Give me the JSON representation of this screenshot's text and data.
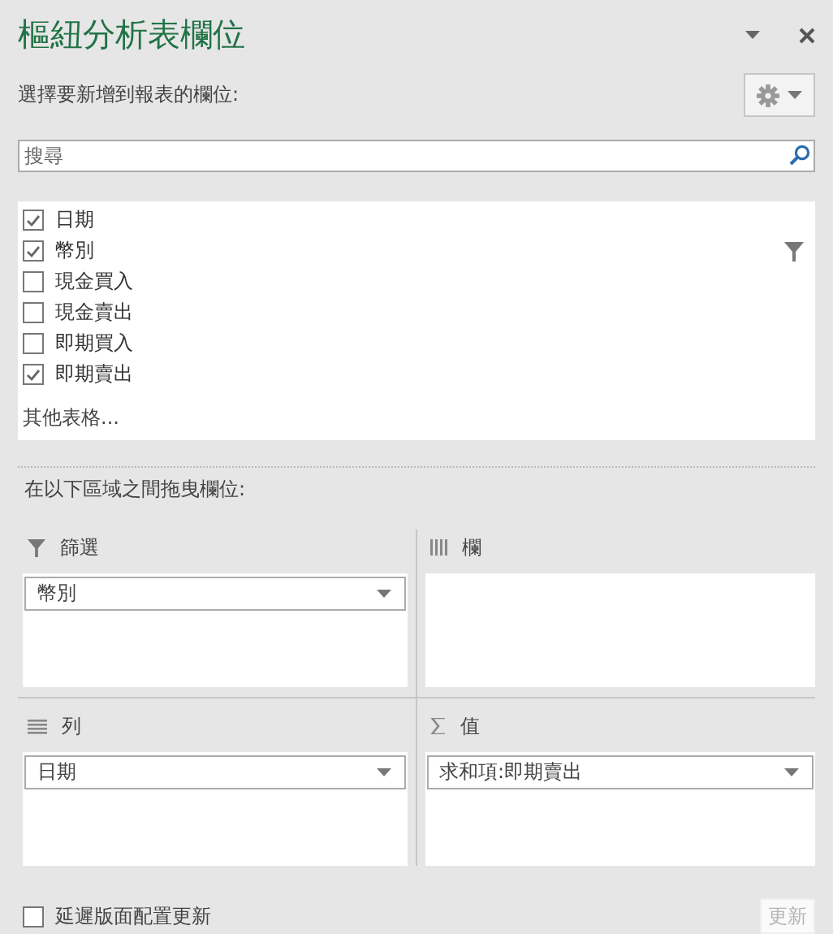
{
  "title": "樞紐分析表欄位",
  "choose_label": "選擇要新增到報表的欄位:",
  "search": {
    "placeholder": "搜尋"
  },
  "fields": [
    {
      "label": "日期",
      "checked": true,
      "filtered": false
    },
    {
      "label": "幣別",
      "checked": true,
      "filtered": true
    },
    {
      "label": "現金買入",
      "checked": false,
      "filtered": false
    },
    {
      "label": "現金賣出",
      "checked": false,
      "filtered": false
    },
    {
      "label": "即期買入",
      "checked": false,
      "filtered": false
    },
    {
      "label": "即期賣出",
      "checked": true,
      "filtered": false
    }
  ],
  "more_tables": "其他表格...",
  "drag_label": "在以下區域之間拖曳欄位:",
  "areas": [
    {
      "kind": "filter",
      "title": "篩選",
      "items": [
        "幣別"
      ]
    },
    {
      "kind": "columns",
      "title": "欄"
    },
    {
      "kind": "rows",
      "title": "列",
      "items": [
        "日期"
      ]
    },
    {
      "kind": "values",
      "title": "值",
      "items": [
        "求和項:即期賣出"
      ]
    }
  ],
  "defer": {
    "label": "延遲版面配置更新",
    "checked": false
  },
  "update_button": {
    "label": "更新",
    "disabled": true
  }
}
